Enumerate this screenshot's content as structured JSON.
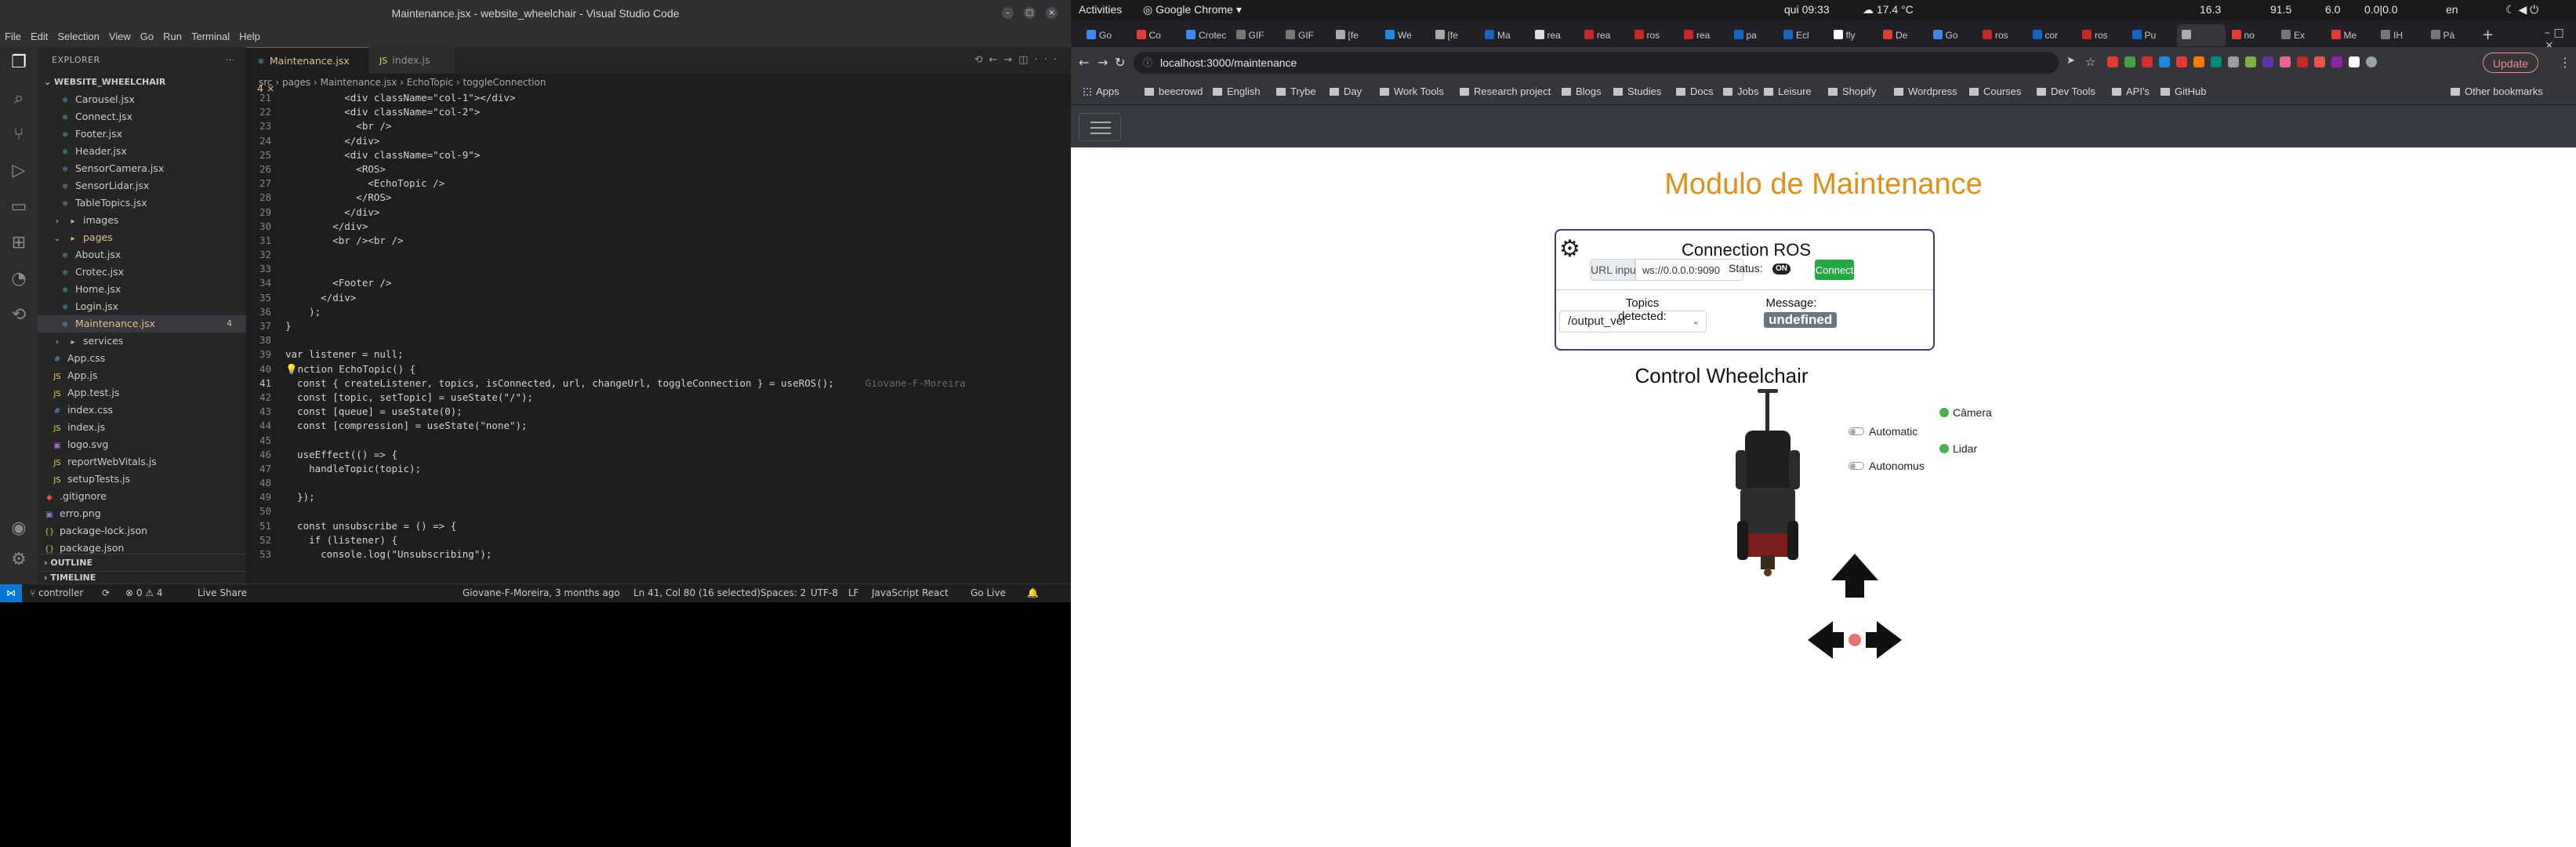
{
  "vscode": {
    "title": "Maintenance.jsx - website_wheelchair - Visual Studio Code",
    "menu": [
      "File",
      "Edit",
      "Selection",
      "View",
      "Go",
      "Run",
      "Terminal",
      "Help"
    ],
    "explorer_header": "EXPLORER",
    "project": "WEBSITE_WHEELCHAIR",
    "tree": [
      {
        "name": "Carousel.jsx",
        "type": "jsx",
        "depth": 2
      },
      {
        "name": "Connect.jsx",
        "type": "jsx",
        "depth": 2
      },
      {
        "name": "Footer.jsx",
        "type": "jsx",
        "depth": 2
      },
      {
        "name": "Header.jsx",
        "type": "jsx",
        "depth": 2
      },
      {
        "name": "SensorCamera.jsx",
        "type": "jsx",
        "depth": 2
      },
      {
        "name": "SensorLidar.jsx",
        "type": "jsx",
        "depth": 2
      },
      {
        "name": "TableTopics.jsx",
        "type": "jsx",
        "depth": 2
      },
      {
        "name": "images",
        "type": "folder",
        "depth": 1,
        "chevron": "›"
      },
      {
        "name": "pages",
        "type": "folder",
        "depth": 1,
        "chevron": "⌄",
        "modified": true
      },
      {
        "name": "About.jsx",
        "type": "jsx",
        "depth": 2
      },
      {
        "name": "Crotec.jsx",
        "type": "jsx",
        "depth": 2
      },
      {
        "name": "Home.jsx",
        "type": "jsx",
        "depth": 2
      },
      {
        "name": "Login.jsx",
        "type": "jsx",
        "depth": 2
      },
      {
        "name": "Maintenance.jsx",
        "type": "jsx",
        "depth": 2,
        "selected": true,
        "modified": true,
        "badge": "4"
      },
      {
        "name": "services",
        "type": "folder",
        "depth": 1,
        "chevron": "›"
      },
      {
        "name": "App.css",
        "type": "css",
        "depth": 1
      },
      {
        "name": "App.js",
        "type": "js",
        "depth": 1
      },
      {
        "name": "App.test.js",
        "type": "js",
        "depth": 1
      },
      {
        "name": "index.css",
        "type": "css",
        "depth": 1
      },
      {
        "name": "index.js",
        "type": "js",
        "depth": 1
      },
      {
        "name": "logo.svg",
        "type": "img",
        "depth": 1
      },
      {
        "name": "reportWebVitals.js",
        "type": "js",
        "depth": 1
      },
      {
        "name": "setupTests.js",
        "type": "js",
        "depth": 1
      },
      {
        "name": ".gitignore",
        "type": "git",
        "depth": 0
      },
      {
        "name": "erro.png",
        "type": "img",
        "depth": 0
      },
      {
        "name": "package-lock.json",
        "type": "json",
        "depth": 0
      },
      {
        "name": "package.json",
        "type": "json",
        "depth": 0
      }
    ],
    "outline_label": "OUTLINE",
    "timeline_label": "TIMELINE",
    "tabs": [
      {
        "label": "Maintenance.jsx",
        "badge": "4",
        "active": true
      },
      {
        "label": "index.js",
        "active": false
      }
    ],
    "breadcrumb": "src › pages › Maintenance.jsx › EchoTopic › toggleConnection",
    "code": [
      {
        "n": "21",
        "t": "          <div className=\"col-1\"></div>"
      },
      {
        "n": "22",
        "t": "          <div className=\"col-2\">"
      },
      {
        "n": "23",
        "t": "            <br />"
      },
      {
        "n": "24",
        "t": "          </div>"
      },
      {
        "n": "25",
        "t": "          <div className=\"col-9\">"
      },
      {
        "n": "26",
        "t": "            <ROS>"
      },
      {
        "n": "27",
        "t": "              <EchoTopic />"
      },
      {
        "n": "28",
        "t": "            </ROS>"
      },
      {
        "n": "29",
        "t": "          </div>"
      },
      {
        "n": "30",
        "t": "        </div>"
      },
      {
        "n": "31",
        "t": "        <br /><br />"
      },
      {
        "n": "32",
        "t": ""
      },
      {
        "n": "33",
        "t": ""
      },
      {
        "n": "34",
        "t": "        <Footer />"
      },
      {
        "n": "35",
        "t": "      </div>"
      },
      {
        "n": "36",
        "t": "    );"
      },
      {
        "n": "37",
        "t": "}"
      },
      {
        "n": "38",
        "t": ""
      },
      {
        "n": "39",
        "t": "var listener = null;"
      },
      {
        "n": "40",
        "t": "💡nction EchoTopic() {"
      },
      {
        "n": "41",
        "t": "  const { createListener, topics, isConnected, url, changeUrl, toggleConnection } = useROS();",
        "blame": "Giovane-F-Moreira"
      },
      {
        "n": "42",
        "t": "  const [topic, setTopic] = useState(\"/\");"
      },
      {
        "n": "43",
        "t": "  const [queue] = useState(0);"
      },
      {
        "n": "44",
        "t": "  const [compression] = useState(\"none\");"
      },
      {
        "n": "45",
        "t": ""
      },
      {
        "n": "46",
        "t": "  useEffect(() => {"
      },
      {
        "n": "47",
        "t": "    handleTopic(topic);"
      },
      {
        "n": "48",
        "t": ""
      },
      {
        "n": "49",
        "t": "  });"
      },
      {
        "n": "50",
        "t": ""
      },
      {
        "n": "51",
        "t": "  const unsubscribe = () => {"
      },
      {
        "n": "52",
        "t": "    if (listener) {"
      },
      {
        "n": "53",
        "t": "      console.log(\"Unsubscribing\");"
      }
    ],
    "status": {
      "branch": "controller",
      "problems": "⊗ 0 ⚠ 4",
      "live_share": "Live Share",
      "blame": "Giovane-F-Moreira, 3 months ago",
      "cursor": "Ln 41, Col 80 (16 selected)",
      "spaces": "Spaces: 2",
      "encoding": "UTF-8",
      "eol": "LF",
      "language": "JavaScript React",
      "golive": "Go Live"
    }
  },
  "gnome": {
    "activities": "Activities",
    "app": "Google Chrome",
    "clock": "qui 09:33",
    "weather": "17.4 °C",
    "indicators": [
      "16.3",
      "91.5",
      "6.0",
      "0.0|0.0",
      "en"
    ]
  },
  "chrome": {
    "tabs": [
      "Go",
      "Co",
      "Crotec",
      "GIF",
      "GIF",
      "[fe",
      "We",
      "[fe",
      "Ma",
      "rea",
      "rea",
      "ros",
      "rea",
      "pa",
      "Ecl",
      "fly",
      "De",
      "Go",
      "ros",
      "cor",
      "ros",
      "Pu",
      "",
      "no",
      "Ex",
      "Me",
      "IH",
      "Pá"
    ],
    "active_tab_index": 22,
    "url": "localhost:3000/maintenance",
    "update_label": "Update",
    "bookmarks": [
      "Apps",
      "beecrowd",
      "English",
      "Trybe",
      "Day",
      "Work Tools",
      "Research project",
      "Blogs",
      "Studies",
      "Docs",
      "Jobs",
      "Leisure",
      "Shopify",
      "Wordpress",
      "Courses",
      "Dev Tools",
      "API's",
      "GitHub"
    ],
    "other_bookmarks": "Other bookmarks"
  },
  "app": {
    "title": "Modulo de Maintenance",
    "connection": {
      "title": "Connection ROS",
      "url_label": "URL input:",
      "url_value": "ws://0.0.0.0:9090",
      "status_label": "Status:",
      "status_value": "ON",
      "connect_label": "Connect",
      "topics_label": "Topics detected:",
      "topic_selected": "/output_vel",
      "message_label": "Message:",
      "message_value": "undefined"
    },
    "control": {
      "title": "Control Wheelchair",
      "toggles": [
        "Automatic",
        "Autonomus"
      ],
      "sensors": [
        "Câmera",
        "Lidar"
      ],
      "sensor_color": "#4caf50"
    }
  }
}
